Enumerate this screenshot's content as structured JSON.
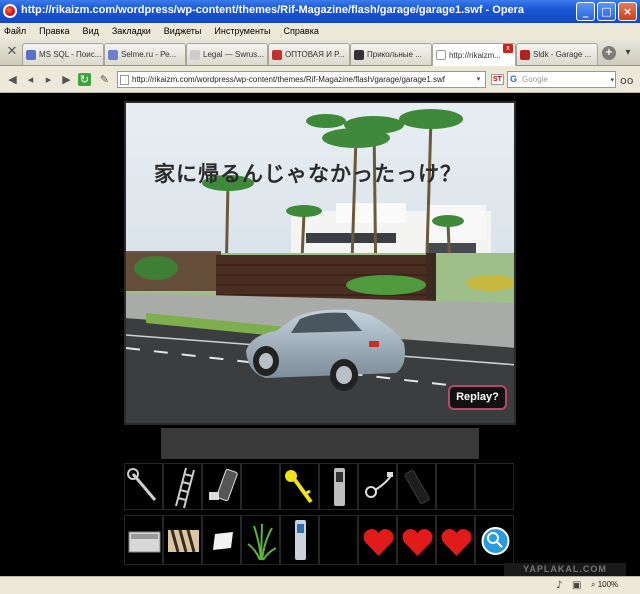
{
  "window": {
    "title": "http://rikaizm.com/wordpress/wp-content/themes/Rif-Magazine/flash/garage/garage1.swf - Opera",
    "minimize_glyph": "_",
    "maximize_glyph": "□",
    "close_glyph": "×"
  },
  "menu": {
    "items": [
      "Файл",
      "Правка",
      "Вид",
      "Закладки",
      "Виджеты",
      "Инструменты",
      "Справка"
    ]
  },
  "tabs": [
    {
      "label": "MS SQL - Поис...",
      "icon_color": "#5a6fc7"
    },
    {
      "label": "Selme.ru - Ре...",
      "icon_color": "#6d7dcf"
    },
    {
      "label": "Legal — Swrus...",
      "icon_color": "#cccccc"
    },
    {
      "label": "ОПТОВАЯ И Р...",
      "icon_color": "#c53030"
    },
    {
      "label": "Прикольные ...",
      "icon_color": "#333333"
    },
    {
      "label": "http://rikaizm...",
      "icon_color": "#ffffff"
    },
    {
      "label": "Sldk - Garage ...",
      "icon_color": "#b22222"
    }
  ],
  "tabbar": {
    "new_tab_glyph": "+",
    "tab_menu_glyph": "▾",
    "tab_close_glyph": "x"
  },
  "toolbar": {
    "address": "http://rikaizm.com/wordpress/wp-content/themes/Rif-Magazine/flash/garage/garage1.swf",
    "search_placeholder": "Google",
    "search_engine_glyph": "G",
    "st_label": "ST",
    "dropdown_glyph": "▾"
  },
  "game": {
    "caption": "家に帰るんじゃなかったっけ？",
    "replay_label": "Replay?",
    "inventory_row1": [
      "wrench",
      "ladder",
      "broken-phone",
      "empty",
      "key",
      "mobile-phone",
      "earphones",
      "dark-device",
      "empty",
      "empty"
    ],
    "inventory_row2": [
      "battery-panel",
      "zebra-fabric",
      "paper-note",
      "grass",
      "handset",
      "empty",
      "heart",
      "heart",
      "heart",
      "magnifier"
    ]
  },
  "colors": {
    "heart": "#e11a1a",
    "key": "#f2e218",
    "magnifier": "#2a9be0",
    "replay_border": "#b34a6a"
  },
  "status": {
    "watermark": "YAPLAKAL.COM",
    "zoom": "100%"
  }
}
